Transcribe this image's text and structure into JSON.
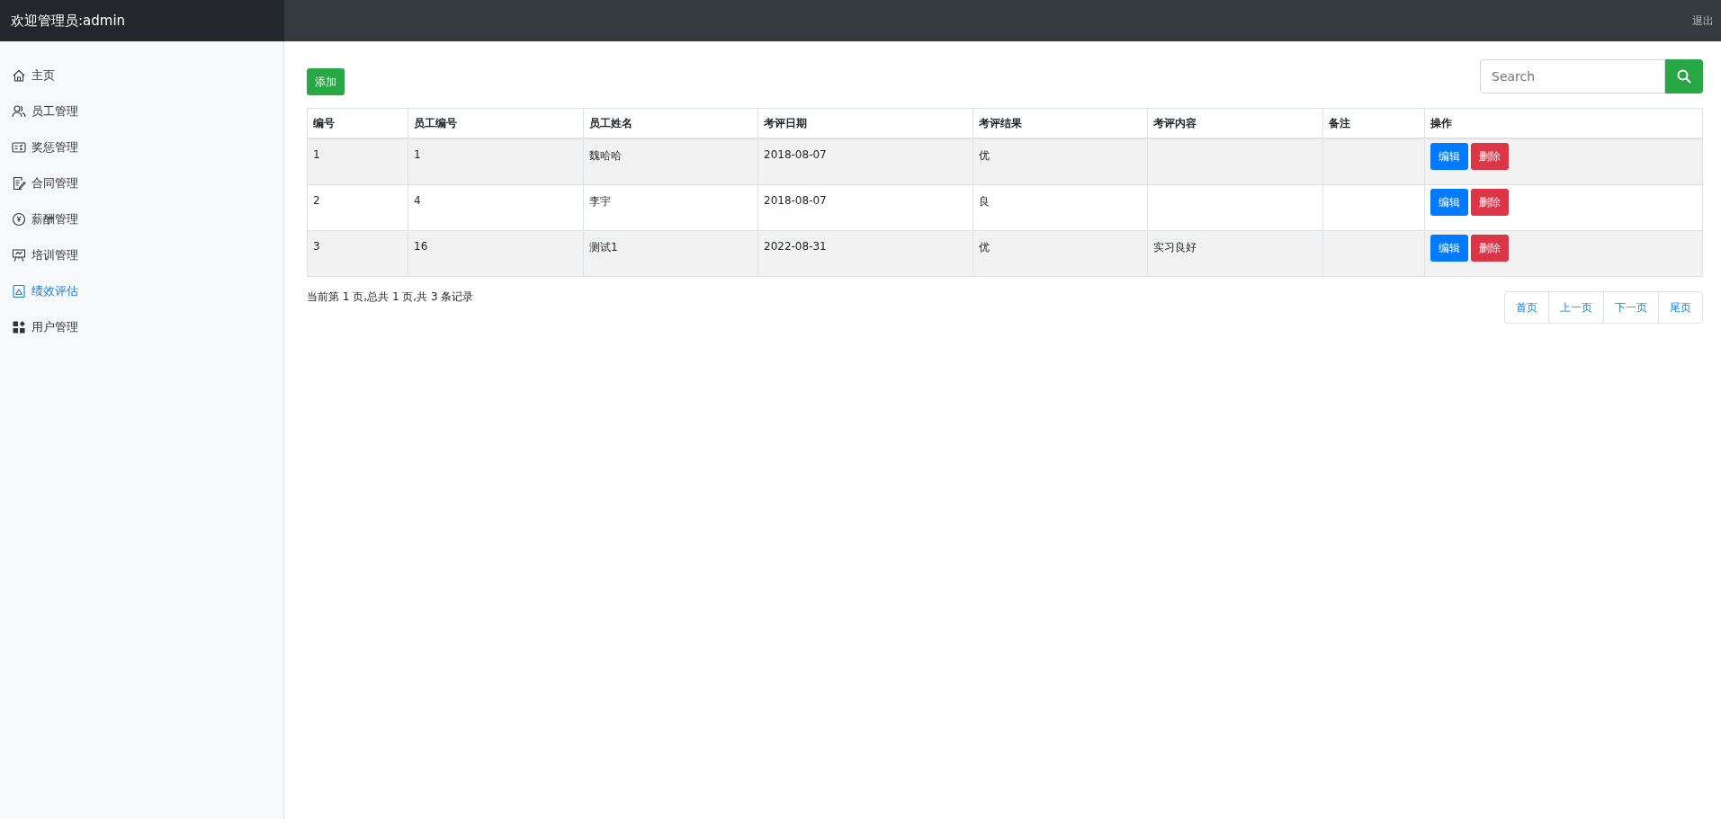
{
  "header": {
    "title": "欢迎管理员:admin",
    "logout": "退出"
  },
  "sidebar": {
    "items": [
      {
        "label": "主页",
        "selected": false
      },
      {
        "label": "员工管理",
        "selected": false
      },
      {
        "label": "奖惩管理",
        "selected": false
      },
      {
        "label": "合同管理",
        "selected": false
      },
      {
        "label": "薪酬管理",
        "selected": false
      },
      {
        "label": "培训管理",
        "selected": false
      },
      {
        "label": "绩效评估",
        "selected": true
      },
      {
        "label": "用户管理",
        "selected": false
      }
    ]
  },
  "toolbar": {
    "add_button": "添加",
    "search": {
      "placeholder": "Search"
    }
  },
  "table": {
    "columns": [
      "编号",
      "员工编号",
      "员工姓名",
      "考评日期",
      "考评结果",
      "考评内容",
      "备注",
      "操作"
    ],
    "rows": [
      {
        "id": "1",
        "employee_no": "1",
        "name": "魏哈哈",
        "date": "2018-08-07",
        "result": "优",
        "actions": [
          "编辑",
          "删除"
        ]
      },
      {
        "id": "2",
        "employee_no": "4",
        "name": "李宇",
        "date": "2018-08-07",
        "result": "良",
        "actions": [
          "编辑",
          "删除"
        ]
      },
      {
        "id": "3",
        "employee_no": "16",
        "name": "测试1",
        "date": "2022-08-31",
        "result": "优",
        "content": "实习良好",
        "actions": [
          "编辑",
          "删除"
        ]
      }
    ]
  },
  "pagination": {
    "info": "当前第 1 页,总共 1 页,共 3 条记录",
    "buttons": [
      "首页",
      "上一页",
      "下一页",
      "尾页"
    ]
  }
}
